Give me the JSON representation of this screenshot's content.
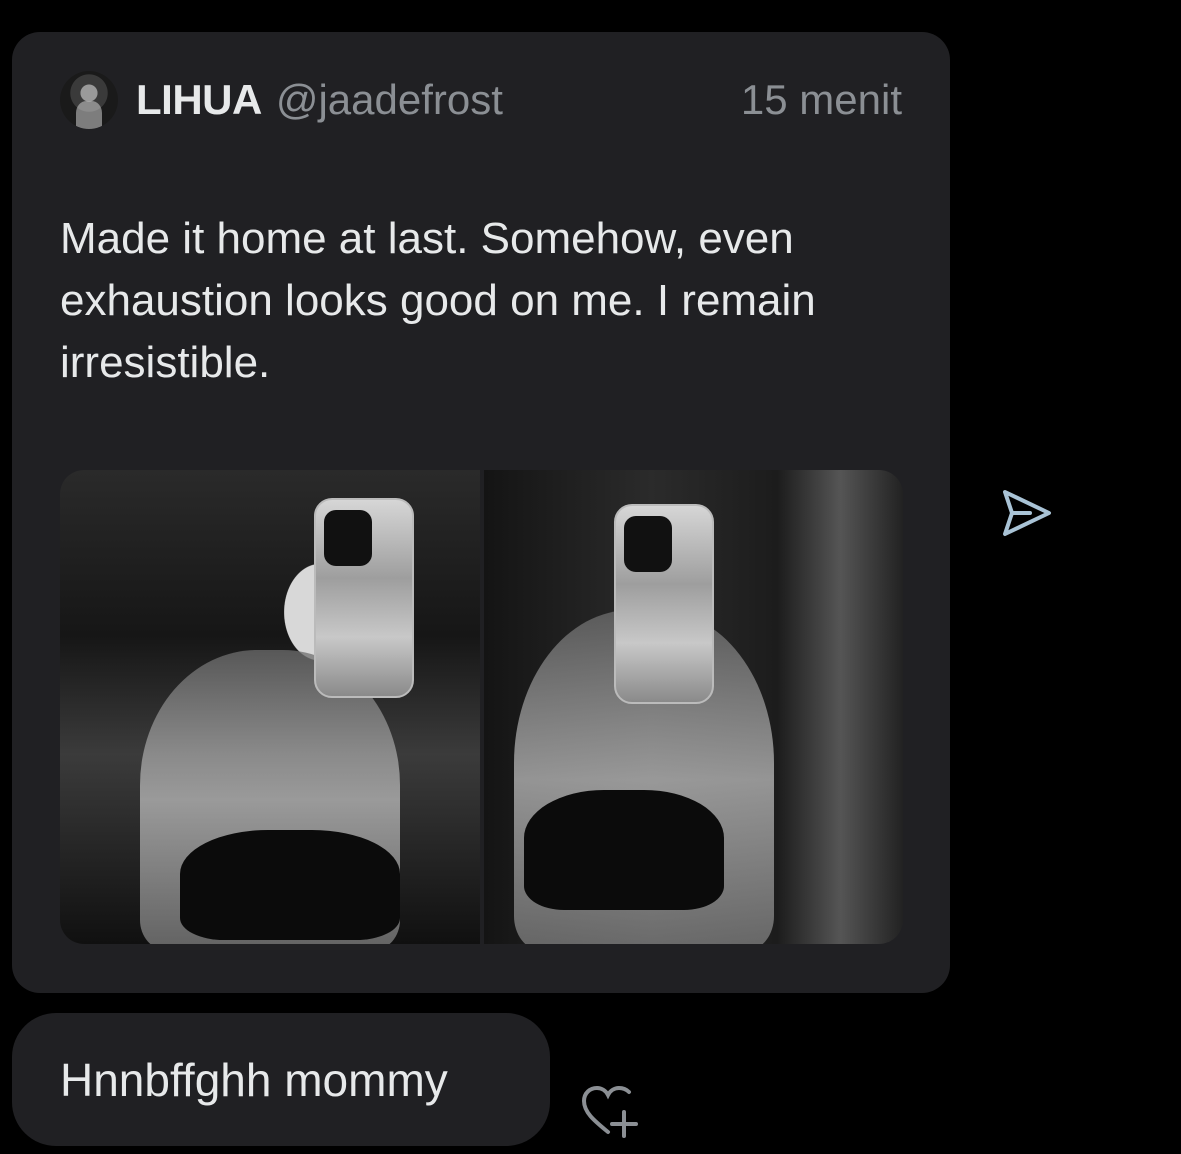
{
  "tweet": {
    "display_name": "LIHUA",
    "handle": "@jaadefrost",
    "time": "15 menit",
    "text": "Made it home at last. Somehow, even exhaustion looks good on me. I remain irresistible."
  },
  "reply": {
    "text": "Hnnbffghh mommy"
  },
  "icons": {
    "share": "send-icon",
    "react": "add-reaction-icon"
  },
  "colors": {
    "background": "#000000",
    "bubble": "#202023",
    "primary_text": "#e7e9ea",
    "secondary_text": "#8b8f94",
    "icon": "#a9c3d6"
  }
}
